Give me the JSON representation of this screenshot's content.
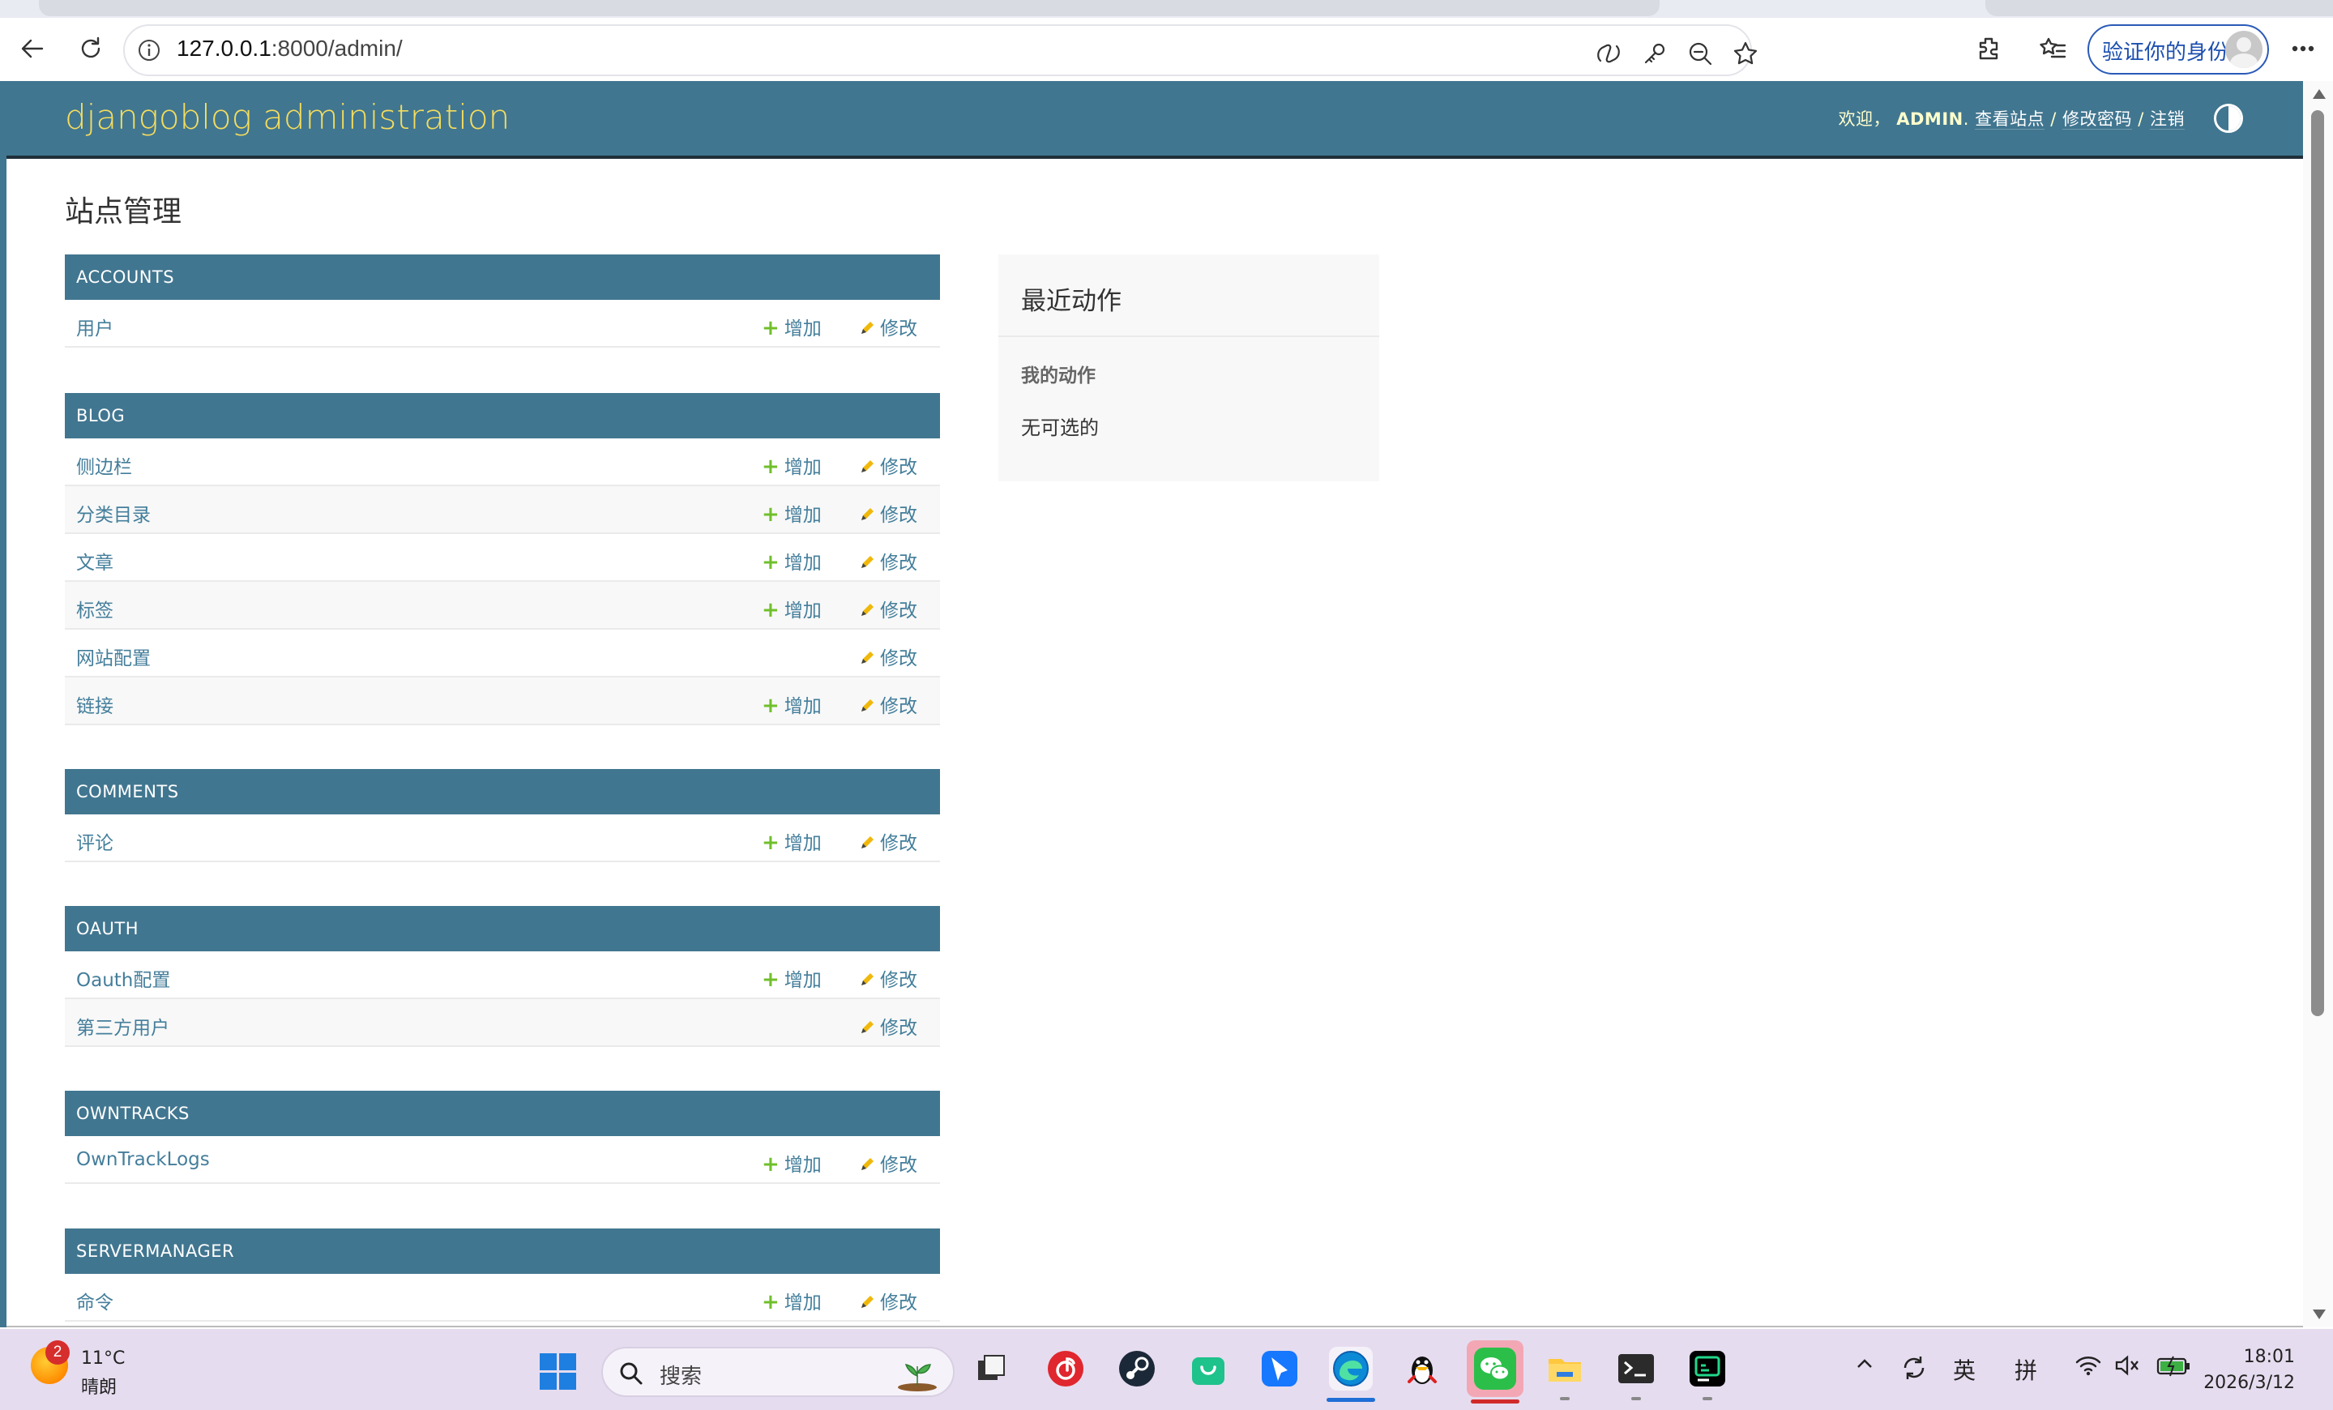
{
  "browser": {
    "url_host": "127.0.0.1",
    "url_path": ":8000/admin/",
    "verify_label": "验证你的身份"
  },
  "header": {
    "branding": "djangoblog administration",
    "welcome": "欢迎，",
    "username": "ADMIN",
    "view_site": "查看站点",
    "change_password": "修改密码",
    "logout": "注销"
  },
  "page": {
    "title": "站点管理"
  },
  "labels": {
    "add": "增加",
    "change": "修改"
  },
  "modules": [
    {
      "caption": "ACCOUNTS",
      "rows": [
        {
          "name": "用户",
          "has_add": true
        }
      ]
    },
    {
      "caption": "BLOG",
      "rows": [
        {
          "name": "侧边栏",
          "has_add": true
        },
        {
          "name": "分类目录",
          "has_add": true
        },
        {
          "name": "文章",
          "has_add": true
        },
        {
          "name": "标签",
          "has_add": true
        },
        {
          "name": "网站配置",
          "has_add": false
        },
        {
          "name": "链接",
          "has_add": true
        }
      ]
    },
    {
      "caption": "COMMENTS",
      "rows": [
        {
          "name": "评论",
          "has_add": true
        }
      ]
    },
    {
      "caption": "OAUTH",
      "rows": [
        {
          "name": "Oauth配置",
          "has_add": true
        },
        {
          "name": "第三方用户",
          "has_add": false
        }
      ]
    },
    {
      "caption": "OWNTRACKS",
      "rows": [
        {
          "name": "OwnTrackLogs",
          "has_add": true
        }
      ]
    },
    {
      "caption": "SERVERMANAGER",
      "rows": [
        {
          "name": "命令",
          "has_add": true
        }
      ]
    }
  ],
  "recent_actions": {
    "title": "最近动作",
    "subtitle": "我的动作",
    "empty": "无可选的"
  },
  "taskbar": {
    "weather_badge": "2",
    "temperature": "11°C",
    "condition": "晴朗",
    "search_placeholder": "搜索",
    "ime_mode": "英",
    "ime_pinyin": "拼",
    "time": "18:01",
    "date": "2026/3/12"
  },
  "colors": {
    "header_bg": "#417690",
    "branding": "#f5dd5d",
    "link": "#447e9b",
    "add_plus": "#70bf2b",
    "change_pencil": "#efb80b"
  }
}
